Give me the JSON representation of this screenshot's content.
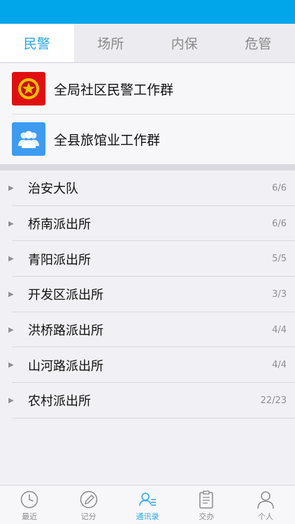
{
  "tabs": [
    {
      "label": "民警",
      "active": true
    },
    {
      "label": "场所",
      "active": false
    },
    {
      "label": "内保",
      "active": false
    },
    {
      "label": "危管",
      "active": false
    }
  ],
  "groups": [
    {
      "name": "全局社区民警工作群",
      "icon": "police-emblem-icon",
      "color": "#e01010"
    },
    {
      "name": "全县旅馆业工作群",
      "icon": "group-people-icon",
      "color": "#3d9bf0"
    }
  ],
  "departments": [
    {
      "name": "治安大队",
      "count": "6/6"
    },
    {
      "name": "桥南派出所",
      "count": "6/6"
    },
    {
      "name": "青阳派出所",
      "count": "5/5"
    },
    {
      "name": "开发区派出所",
      "count": "3/3"
    },
    {
      "name": "洪桥路派出所",
      "count": "4/4"
    },
    {
      "name": "山河路派出所",
      "count": "4/4"
    },
    {
      "name": "农村派出所",
      "count": "22/23"
    }
  ],
  "bottom_nav": [
    {
      "label": "最近",
      "icon": "clock-icon",
      "active": false
    },
    {
      "label": "记分",
      "icon": "pencil-icon",
      "active": false
    },
    {
      "label": "通讯录",
      "icon": "contacts-icon",
      "active": true
    },
    {
      "label": "交办",
      "icon": "clipboard-icon",
      "active": false
    },
    {
      "label": "个人",
      "icon": "person-icon",
      "active": false
    }
  ],
  "colors": {
    "accent": "#29a6e8",
    "status_bar": "#01a5ea"
  }
}
